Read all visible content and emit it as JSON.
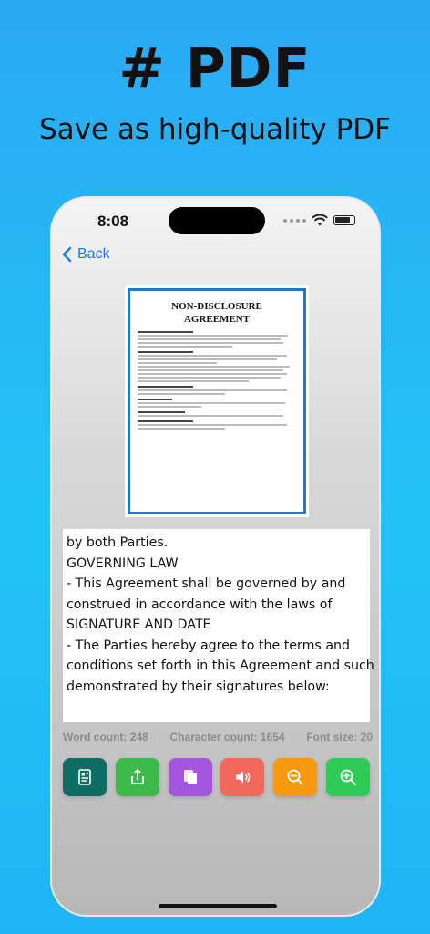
{
  "headline": "# PDF",
  "subline": "Save as high-quality PDF",
  "status": {
    "time": "8:08"
  },
  "nav": {
    "back_label": "Back"
  },
  "document": {
    "title_line1": "NON-DISCLOSURE",
    "title_line2": "AGREEMENT"
  },
  "text_lines": [
    "by both Parties.",
    "GOVERNING LAW",
    "- This Agreement shall be governed by and",
    "construed in accordance with the laws of",
    "SIGNATURE AND DATE",
    "- The Parties hereby agree to the terms and",
    "conditions set forth in this Agreement and such is",
    "demonstrated by their signatures below:"
  ],
  "stats": {
    "word_count": "Word count: 248",
    "character_count": "Character count: 1654",
    "font_size": "Font size: 20"
  },
  "toolbar": [
    {
      "icon": "scan-text-icon",
      "color": "#0e6e63"
    },
    {
      "icon": "share-icon",
      "color": "#3dbb4a"
    },
    {
      "icon": "copy-icon",
      "color": "#a455e0"
    },
    {
      "icon": "speaker-icon",
      "color": "#f26a5e"
    },
    {
      "icon": "zoom-out-icon",
      "color": "#f79a12"
    },
    {
      "icon": "zoom-in-icon",
      "color": "#2fcb57"
    }
  ]
}
